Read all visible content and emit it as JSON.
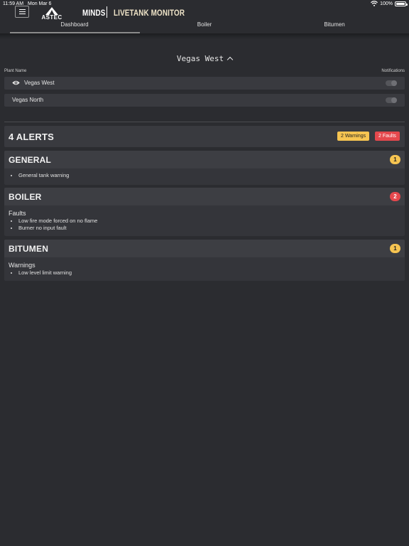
{
  "status": {
    "time": "11:59 AM",
    "date": "Mon Mar 6",
    "battery": "100%",
    "battery_level": 1.0
  },
  "header": {
    "logo_text": "ASTEC",
    "brand": "MINDS",
    "app_title": "LIVETANK MONITOR"
  },
  "tabs": [
    {
      "label": "Dashboard",
      "active": true
    },
    {
      "label": "Boiler",
      "active": false
    },
    {
      "label": "Bitumen",
      "active": false
    }
  ],
  "plant_selector": {
    "label": "Vegas West"
  },
  "plants": {
    "col_name": "Plant Name",
    "col_notifications": "Notifications",
    "rows": [
      {
        "name": "Vegas West",
        "selected": true,
        "notifications": false
      },
      {
        "name": "Vegas North",
        "selected": false,
        "notifications": false
      }
    ]
  },
  "alerts": {
    "title": "4 ALERTS",
    "warnings_label": "2 Warnings",
    "faults_label": "2 Faults",
    "groups": [
      {
        "title": "GENERAL",
        "count": "1",
        "severity": "warning",
        "subheading": "",
        "items": [
          "General tank warning"
        ]
      },
      {
        "title": "BOILER",
        "count": "2",
        "severity": "fault",
        "subheading": "Faults",
        "items": [
          "Low fire mode forced on no flame",
          "Burner no input fault"
        ]
      },
      {
        "title": "BITUMEN",
        "count": "1",
        "severity": "warning",
        "subheading": "Warnings",
        "items": [
          "Low level limit warning"
        ]
      }
    ]
  },
  "colors": {
    "warning": "#f6c451",
    "fault": "#e5484d",
    "background": "#2b2c30",
    "app_title": "#efe4c8"
  }
}
